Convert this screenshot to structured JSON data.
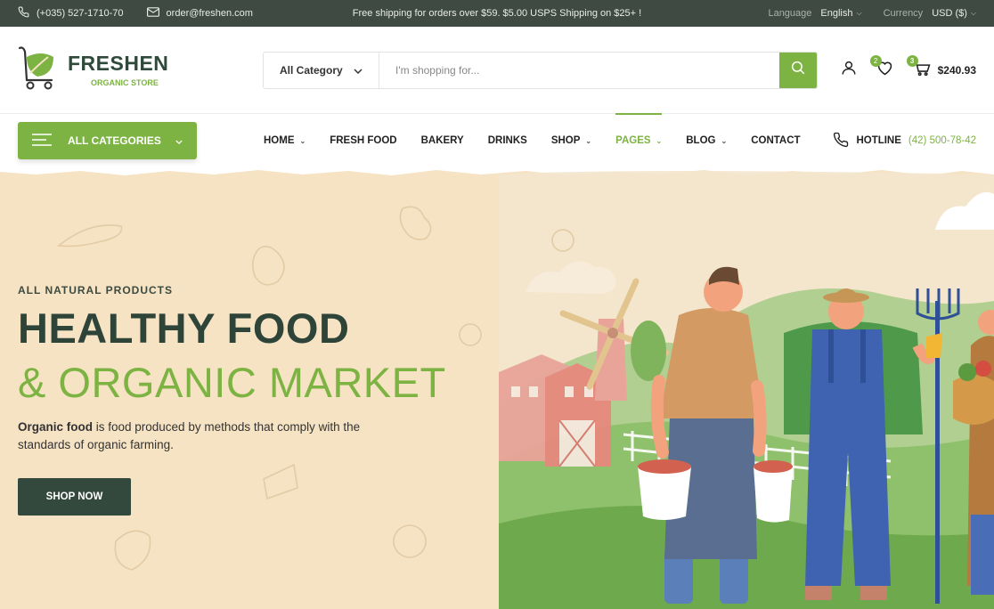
{
  "topbar": {
    "phone": "(+035) 527-1710-70",
    "email": "order@freshen.com",
    "promo": "Free shipping for orders over $59. $5.00 USPS Shipping on $25+ !",
    "language_label": "Language",
    "language_value": "English",
    "currency_label": "Currency",
    "currency_value": "USD ($)"
  },
  "header": {
    "brand": "FRESHEN",
    "tagline": "ORGANIC STORE",
    "search": {
      "category": "All Category",
      "placeholder": "I'm shopping for..."
    },
    "wishlist_count": "2",
    "cart_count": "3",
    "cart_total": "$240.93"
  },
  "nav": {
    "all_categories": "ALL CATEGORIES",
    "items": [
      {
        "label": "HOME",
        "dropdown": true
      },
      {
        "label": "FRESH FOOD",
        "dropdown": false
      },
      {
        "label": "BAKERY",
        "dropdown": false
      },
      {
        "label": "DRINKS",
        "dropdown": false
      },
      {
        "label": "SHOP",
        "dropdown": true
      },
      {
        "label": "PAGES",
        "dropdown": true,
        "active": true
      },
      {
        "label": "BLOG",
        "dropdown": true
      },
      {
        "label": "CONTACT",
        "dropdown": false
      }
    ],
    "hotline_label": "HOTLINE",
    "hotline_number": "(42) 500-78-42"
  },
  "hero": {
    "kicker": "ALL NATURAL PRODUCTS",
    "title_line1": "HEALTHY FOOD",
    "title_line2": "& ORGANIC MARKET",
    "desc_bold": "Organic food",
    "desc_rest": " is food produced by methods that comply with the standards of organic farming.",
    "cta": "SHOP NOW"
  },
  "colors": {
    "accent": "#7cb342",
    "dark": "#34493d",
    "topbar": "#3e4a42",
    "hero_bg": "#f6e3c4"
  },
  "icons": [
    "phone-icon",
    "mail-icon",
    "chevron-down-icon",
    "search-icon",
    "user-icon",
    "heart-icon",
    "cart-icon",
    "menu-icon"
  ]
}
